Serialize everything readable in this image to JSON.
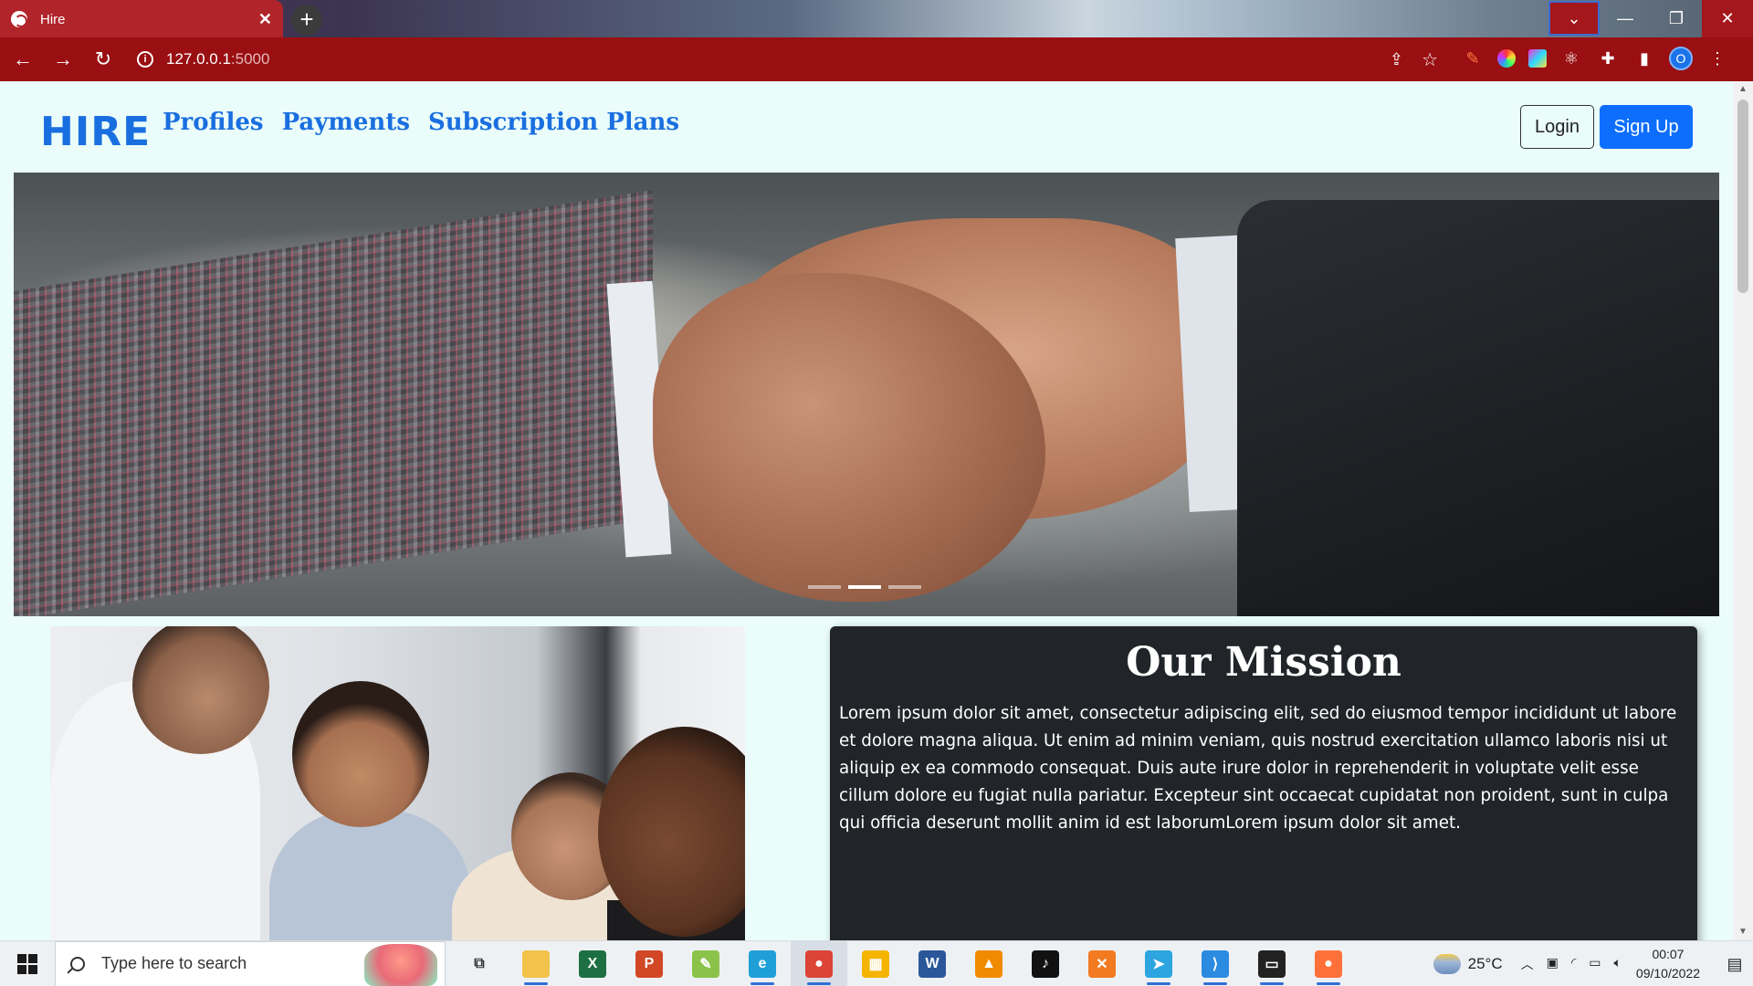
{
  "browser": {
    "tab_title": "Hire",
    "tab_close": "✕",
    "new_tab": "+",
    "url": "127.0.0.1",
    "url_port": ":5000",
    "window_buttons": {
      "dropdown": "⌄",
      "minimize": "—",
      "restore": "❐",
      "close": "✕"
    },
    "nav": {
      "back": "←",
      "forward": "→",
      "reload": "↻"
    },
    "avatar_initial": "O",
    "extensions": [
      "pen-icon",
      "color-wheel-icon",
      "gradient-icon",
      "react-icon",
      "puzzle-icon",
      "sidepanel-icon"
    ]
  },
  "site": {
    "brand": "HIRE",
    "nav_links": [
      "Profiles",
      "Payments",
      "Subscription Plans"
    ],
    "login_label": "Login",
    "signup_label": "Sign Up"
  },
  "carousel": {
    "slide_count": 3,
    "active_index": 1
  },
  "mission": {
    "title": "Our Mission",
    "body": "Lorem ipsum dolor sit amet, consectetur adipiscing elit, sed do eiusmod tempor incididunt ut labore et dolore magna aliqua. Ut enim ad minim veniam, quis nostrud exercitation ullamco laboris nisi ut aliquip ex ea commodo consequat. Duis aute irure dolor in reprehenderit in voluptate velit esse cillum dolore eu fugiat nulla pariatur. Excepteur sint occaecat cupidatat non proident, sunt in culpa qui officia deserunt mollit anim id est laborumLorem ipsum dolor sit amet."
  },
  "taskbar": {
    "search_placeholder": "Type here to search",
    "apps": [
      {
        "name": "task-view",
        "label": "⧉",
        "color": "#eef1f4",
        "fg": "#333"
      },
      {
        "name": "file-explorer",
        "label": "",
        "color": "#f2c24a",
        "fg": "#fff"
      },
      {
        "name": "excel",
        "label": "X",
        "color": "#1d7044",
        "fg": "#fff"
      },
      {
        "name": "powerpoint",
        "label": "P",
        "color": "#d24726",
        "fg": "#fff"
      },
      {
        "name": "notepad-plus",
        "label": "✎",
        "color": "#8bc34a",
        "fg": "#fff"
      },
      {
        "name": "edge",
        "label": "e",
        "color": "#1f9fd8",
        "fg": "#fff"
      },
      {
        "name": "chrome",
        "label": "●",
        "color": "#db4437",
        "fg": "#fff"
      },
      {
        "name": "store",
        "label": "▦",
        "color": "#f4b400",
        "fg": "#fff"
      },
      {
        "name": "word",
        "label": "W",
        "color": "#2b579a",
        "fg": "#fff"
      },
      {
        "name": "vlc",
        "label": "▲",
        "color": "#f08a00",
        "fg": "#fff"
      },
      {
        "name": "tiktok",
        "label": "♪",
        "color": "#111",
        "fg": "#fff"
      },
      {
        "name": "xampp",
        "label": "✕",
        "color": "#f27b21",
        "fg": "#fff"
      },
      {
        "name": "telegram",
        "label": "➤",
        "color": "#2ca5e0",
        "fg": "#fff"
      },
      {
        "name": "vscode",
        "label": "⟩",
        "color": "#2a8be0",
        "fg": "#fff"
      },
      {
        "name": "terminal",
        "label": "▭",
        "color": "#222",
        "fg": "#fff"
      },
      {
        "name": "firefox",
        "label": "●",
        "color": "#ff7139",
        "fg": "#fff"
      }
    ],
    "temperature": "25°C",
    "time": "00:07",
    "date": "09/10/2022"
  }
}
